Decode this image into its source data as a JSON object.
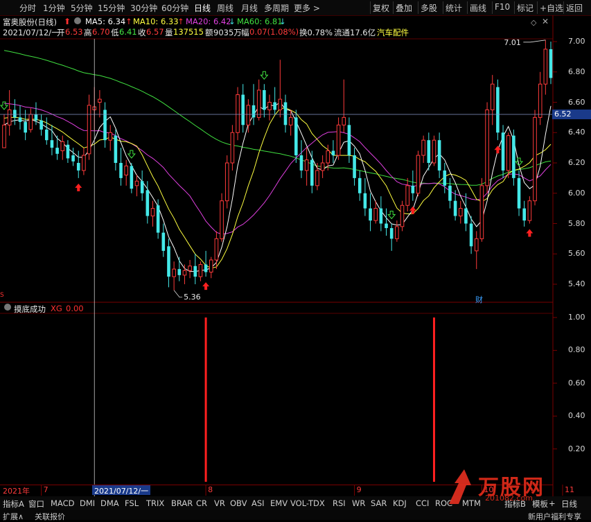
{
  "toolbar": {
    "periods": [
      "分时",
      "1分钟",
      "5分钟",
      "15分钟",
      "30分钟",
      "60分钟",
      "日线",
      "周线",
      "月线",
      "多周期",
      "更多 >"
    ],
    "active_period": "日线",
    "right_buttons": [
      "复权",
      "叠加",
      "多股",
      "统计",
      "画线",
      "F10",
      "标记",
      "+自选",
      "返回"
    ]
  },
  "stock": {
    "title": "富奥股份(日线)",
    "ma5": "MA5: 6.34",
    "ma10": "MA10: 6.33",
    "ma20": "MA20: 6.42",
    "ma60": "MA60: 6.81",
    "date": "2021/07/12/一",
    "open_label": "开",
    "open": "6.53",
    "high_label": "高",
    "high": "6.70",
    "low_label": "低",
    "low": "6.41",
    "close_label": "收",
    "close": "6.57",
    "vol_label": "量",
    "vol": "137515",
    "amount_label": "额",
    "amount": "9035万",
    "change_label": "幅",
    "change": "0.07(1.08%)",
    "turnover": "换0.78%",
    "float": "流通17.6亿",
    "sector": "汽车配件"
  },
  "indicator": {
    "name": "摸底成功",
    "series": "XG",
    "value": "0.00"
  },
  "labels": {
    "max": "7.01",
    "min": "5.36",
    "current": "6.52",
    "year": "2021年",
    "cursor_date": "2021/07/12/一",
    "cai": "财",
    "s_mark": "S"
  },
  "bottom_tabs": [
    "指标A",
    "窗口",
    "MACD",
    "DMI",
    "DMA",
    "FSL",
    "TRIX",
    "BRAR",
    "CR",
    "VR",
    "OBV",
    "ASI",
    "EMV",
    "VOL-TDX",
    "RSI",
    "WR",
    "SAR",
    "KDJ",
    "CCI",
    "ROC",
    "MTM",
    "指标B",
    "模板",
    "+",
    "日线"
  ],
  "status": [
    "扩展∧",
    "关联报价",
    "新用户福利专享"
  ],
  "watermark": {
    "text": "万股网",
    "sub": "201082.com"
  },
  "colors": {
    "up": "#ff3b3b",
    "down": "#44e8e8",
    "ma5": "#ffffff",
    "ma10": "#ffff40",
    "ma20": "#e040e0",
    "ma60": "#40e040",
    "xg": "#ff2020"
  },
  "chart_data": [
    {
      "type": "candlestick",
      "title": "富奥股份(日线)",
      "ylim": [
        5.3,
        7.1
      ],
      "yticks": [
        5.4,
        5.6,
        5.8,
        6.0,
        6.2,
        6.4,
        6.6,
        6.8,
        7.0
      ],
      "x_month_labels": [
        "7",
        "8",
        "9",
        "10",
        "11"
      ],
      "max_label": 7.01,
      "min_label": 5.36,
      "current_price": 6.52,
      "ohlc": [
        [
          6.3,
          6.52,
          6.3,
          6.45
        ],
        [
          6.45,
          6.68,
          6.38,
          6.55
        ],
        [
          6.55,
          6.62,
          6.45,
          6.5
        ],
        [
          6.5,
          6.58,
          6.42,
          6.47
        ],
        [
          6.47,
          6.55,
          6.35,
          6.4
        ],
        [
          6.42,
          6.56,
          6.4,
          6.52
        ],
        [
          6.52,
          6.6,
          6.45,
          6.48
        ],
        [
          6.48,
          6.52,
          6.38,
          6.42
        ],
        [
          6.42,
          6.5,
          6.32,
          6.35
        ],
        [
          6.35,
          6.45,
          6.25,
          6.3
        ],
        [
          6.3,
          6.38,
          6.22,
          6.26
        ],
        [
          6.28,
          6.38,
          6.22,
          6.34
        ],
        [
          6.32,
          6.35,
          6.2,
          6.23
        ],
        [
          6.25,
          6.3,
          6.18,
          6.21
        ],
        [
          6.2,
          6.28,
          6.1,
          6.15
        ],
        [
          6.15,
          6.3,
          6.12,
          6.25
        ],
        [
          6.26,
          6.65,
          6.22,
          6.58
        ],
        [
          6.55,
          6.7,
          6.41,
          6.57
        ],
        [
          6.6,
          6.68,
          6.5,
          6.62
        ],
        [
          6.55,
          6.6,
          6.3,
          6.35
        ],
        [
          6.35,
          6.45,
          6.28,
          6.4
        ],
        [
          6.38,
          6.42,
          6.15,
          6.2
        ],
        [
          6.2,
          6.3,
          6.05,
          6.1
        ],
        [
          6.12,
          6.22,
          6.05,
          6.18
        ],
        [
          6.18,
          6.2,
          6.0,
          6.03
        ],
        [
          6.05,
          6.12,
          5.98,
          6.08
        ],
        [
          6.08,
          6.15,
          5.95,
          6.0
        ],
        [
          6.02,
          6.08,
          5.8,
          5.85
        ],
        [
          5.85,
          5.95,
          5.78,
          5.9
        ],
        [
          5.92,
          5.96,
          5.7,
          5.74
        ],
        [
          5.74,
          5.8,
          5.58,
          5.62
        ],
        [
          5.65,
          5.7,
          5.38,
          5.45
        ],
        [
          5.45,
          5.55,
          5.36,
          5.5
        ],
        [
          5.5,
          5.58,
          5.42,
          5.46
        ],
        [
          5.46,
          5.53,
          5.4,
          5.49
        ],
        [
          5.49,
          5.56,
          5.44,
          5.52
        ],
        [
          5.52,
          5.6,
          5.4,
          5.45
        ],
        [
          5.45,
          5.55,
          5.42,
          5.53
        ],
        [
          5.53,
          5.62,
          5.45,
          5.48
        ],
        [
          5.48,
          5.58,
          5.44,
          5.56
        ],
        [
          5.56,
          5.75,
          5.5,
          5.7
        ],
        [
          5.7,
          6.0,
          5.68,
          5.95
        ],
        [
          5.95,
          6.25,
          5.9,
          6.2
        ],
        [
          6.2,
          6.45,
          6.15,
          6.4
        ],
        [
          6.4,
          6.7,
          6.35,
          6.65
        ],
        [
          6.65,
          6.72,
          6.4,
          6.45
        ],
        [
          6.45,
          6.62,
          6.4,
          6.58
        ],
        [
          6.58,
          6.72,
          6.45,
          6.5
        ],
        [
          6.5,
          6.75,
          6.48,
          6.68
        ],
        [
          6.68,
          6.72,
          6.5,
          6.55
        ],
        [
          6.55,
          6.65,
          6.48,
          6.6
        ],
        [
          6.6,
          6.7,
          6.52,
          6.55
        ],
        [
          6.55,
          6.88,
          6.5,
          6.62
        ],
        [
          6.6,
          6.65,
          6.4,
          6.45
        ],
        [
          6.45,
          6.55,
          6.38,
          6.5
        ],
        [
          6.5,
          6.55,
          6.2,
          6.25
        ],
        [
          6.25,
          6.35,
          6.1,
          6.15
        ],
        [
          6.15,
          6.3,
          6.05,
          6.22
        ],
        [
          6.22,
          6.28,
          6.0,
          6.05
        ],
        [
          6.05,
          6.2,
          6.02,
          6.15
        ],
        [
          6.15,
          6.25,
          6.1,
          6.2
        ],
        [
          6.2,
          6.32,
          6.15,
          6.28
        ],
        [
          6.28,
          6.35,
          6.2,
          6.25
        ],
        [
          6.25,
          6.5,
          6.22,
          6.45
        ],
        [
          6.45,
          6.75,
          6.4,
          6.5
        ],
        [
          6.45,
          6.5,
          6.2,
          6.25
        ],
        [
          6.25,
          6.3,
          6.05,
          6.1
        ],
        [
          6.1,
          6.15,
          5.95,
          6.0
        ],
        [
          6.0,
          6.1,
          5.85,
          5.9
        ],
        [
          5.9,
          6.0,
          5.75,
          5.82
        ],
        [
          5.82,
          5.95,
          5.8,
          5.9
        ],
        [
          5.9,
          5.98,
          5.75,
          5.8
        ],
        [
          5.8,
          5.9,
          5.72,
          5.77
        ],
        [
          5.77,
          5.8,
          5.62,
          5.7
        ],
        [
          5.7,
          5.82,
          5.68,
          5.78
        ],
        [
          5.78,
          5.95,
          5.75,
          5.92
        ],
        [
          5.92,
          6.1,
          5.88,
          6.05
        ],
        [
          6.05,
          6.15,
          5.95,
          6.0
        ],
        [
          6.0,
          6.28,
          5.98,
          6.25
        ],
        [
          6.25,
          6.38,
          6.2,
          6.35
        ],
        [
          6.35,
          6.4,
          6.15,
          6.2
        ],
        [
          6.2,
          6.38,
          6.18,
          6.35
        ],
        [
          6.35,
          6.4,
          6.1,
          6.15
        ],
        [
          6.15,
          6.2,
          6.0,
          6.05
        ],
        [
          6.05,
          6.1,
          5.9,
          5.95
        ],
        [
          5.95,
          6.02,
          5.82,
          5.85
        ],
        [
          5.85,
          5.95,
          5.8,
          5.9
        ],
        [
          5.9,
          6.0,
          5.75,
          5.8
        ],
        [
          5.8,
          5.85,
          5.6,
          5.65
        ],
        [
          5.62,
          5.75,
          5.5,
          5.7
        ],
        [
          5.7,
          6.1,
          5.68,
          6.05
        ],
        [
          6.05,
          6.6,
          6.0,
          6.55
        ],
        [
          6.55,
          6.78,
          6.45,
          6.72
        ],
        [
          6.7,
          6.75,
          6.35,
          6.4
        ],
        [
          6.4,
          6.45,
          6.1,
          6.15
        ],
        [
          6.15,
          6.4,
          6.1,
          6.38
        ],
        [
          6.38,
          6.42,
          6.05,
          6.1
        ],
        [
          6.1,
          6.15,
          5.85,
          5.9
        ],
        [
          5.9,
          5.95,
          5.78,
          5.82
        ],
        [
          5.82,
          5.98,
          5.8,
          5.95
        ],
        [
          5.95,
          6.55,
          5.92,
          6.5
        ],
        [
          6.5,
          6.8,
          6.45,
          6.72
        ],
        [
          6.72,
          7.01,
          6.65,
          6.95
        ],
        [
          6.95,
          7.0,
          6.72,
          6.76
        ]
      ]
    },
    {
      "type": "bar",
      "title": "摸底成功",
      "series_name": "XG",
      "ylim": [
        0,
        1.05
      ],
      "yticks": [
        0.2,
        0.4,
        0.6,
        0.8,
        1.0
      ],
      "signals_at_index": [
        38,
        81
      ],
      "signal_value": 1.0,
      "current_value": 0.0
    }
  ]
}
